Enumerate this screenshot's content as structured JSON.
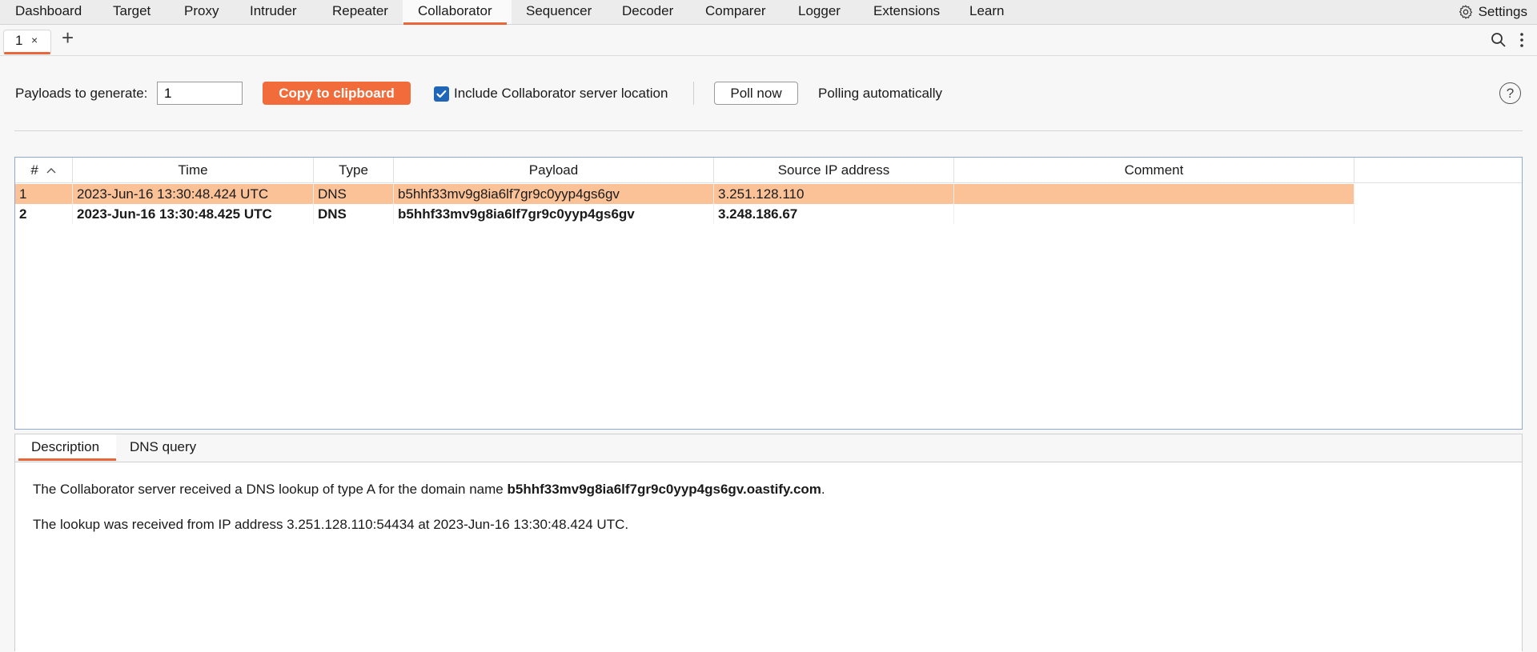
{
  "nav": {
    "tabs": [
      "Dashboard",
      "Target",
      "Proxy",
      "Intruder",
      "Repeater",
      "Collaborator",
      "Sequencer",
      "Decoder",
      "Comparer",
      "Logger",
      "Extensions",
      "Learn"
    ],
    "active": "Collaborator",
    "settings_label": "Settings"
  },
  "subtabs": {
    "tab1_label": "1",
    "tab1_close": "×",
    "add_label": "+"
  },
  "controls": {
    "payloads_label": "Payloads to generate:",
    "payloads_value": "1",
    "copy_label": "Copy to clipboard",
    "include_label": "Include Collaborator server location",
    "include_checked": true,
    "poll_label": "Poll now",
    "polling_status": "Polling automatically",
    "help_glyph": "?"
  },
  "table": {
    "columns": [
      "#",
      "Time",
      "Type",
      "Payload",
      "Source IP address",
      "Comment"
    ],
    "sort_indicator": "^",
    "rows": [
      {
        "num": "1",
        "time": "2023-Jun-16 13:30:48.424 UTC",
        "type": "DNS",
        "payload": "b5hhf33mv9g8ia6lf7gr9c0yyp4gs6gv",
        "ip": "3.251.128.110",
        "comment": "",
        "selected": true,
        "bold": false
      },
      {
        "num": "2",
        "time": "2023-Jun-16 13:30:48.425 UTC",
        "type": "DNS",
        "payload": "b5hhf33mv9g8ia6lf7gr9c0yyp4gs6gv",
        "ip": "3.248.186.67",
        "comment": "",
        "selected": false,
        "bold": true
      }
    ]
  },
  "details": {
    "tabs": [
      "Description",
      "DNS query"
    ],
    "active": "Description",
    "line1_prefix": "The Collaborator server received a DNS lookup of type A for the domain name ",
    "line1_domain": "b5hhf33mv9g8ia6lf7gr9c0yyp4gs6gv.oastify.com",
    "line1_suffix": ".",
    "line2": "The lookup was received from IP address 3.251.128.110:54434 at 2023-Jun-16 13:30:48.424 UTC."
  },
  "colors": {
    "accent": "#f26b3a",
    "selected_row": "#fbc298",
    "checkbox": "#1f66b8"
  }
}
